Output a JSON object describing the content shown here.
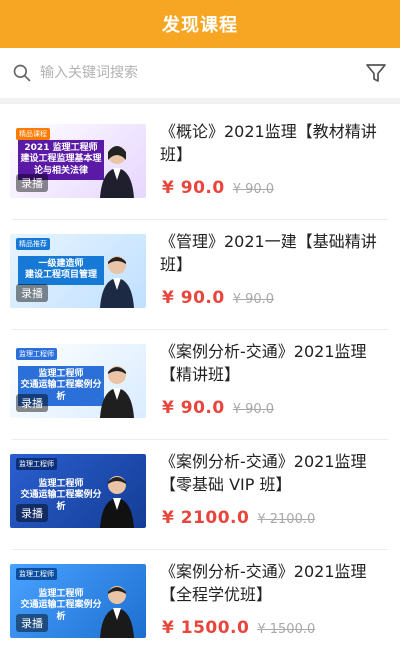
{
  "header": {
    "title": "发现课程"
  },
  "search": {
    "placeholder": "输入关键词搜索"
  },
  "courses": [
    {
      "title": "《概论》2021监理【教材精讲班】",
      "price": "¥ 90.0",
      "original_price": "¥ 90.0",
      "badge": "录播",
      "thumb_tag": "精品课程",
      "thumb_lines": [
        "2021 监理工程师",
        "建设工程监理基本理论与相关法律"
      ],
      "theme": "#6a1fb0"
    },
    {
      "title": "《管理》2021一建【基础精讲班】",
      "price": "¥ 90.0",
      "original_price": "¥ 90.0",
      "badge": "录播",
      "thumb_tag": "精品推荐",
      "thumb_lines": [
        "一级建造师",
        "建设工程项目管理"
      ],
      "theme": "#1679d6"
    },
    {
      "title": "《案例分析-交通》2021监理【精讲班】",
      "price": "¥ 90.0",
      "original_price": "¥ 90.0",
      "badge": "录播",
      "thumb_tag": "监理工程师",
      "thumb_lines": [
        "监理工程师",
        "交通运输工程案例分析"
      ],
      "theme": "#2b6fd8"
    },
    {
      "title": "《案例分析-交通》2021监理【零基础 VIP 班】",
      "price": "¥ 2100.0",
      "original_price": "¥ 2100.0",
      "badge": "录播",
      "thumb_tag": "监理工程师",
      "thumb_lines": [
        "监理工程师",
        "交通运输工程案例分析"
      ],
      "theme": "#1e4fb3"
    },
    {
      "title": "《案例分析-交通》2021监理【全程学优班】",
      "price": "¥ 1500.0",
      "original_price": "¥ 1500.0",
      "badge": "录播",
      "thumb_tag": "监理工程师",
      "thumb_lines": [
        "监理工程师",
        "交通运输工程案例分析"
      ],
      "theme": "#1d6fcf"
    }
  ]
}
